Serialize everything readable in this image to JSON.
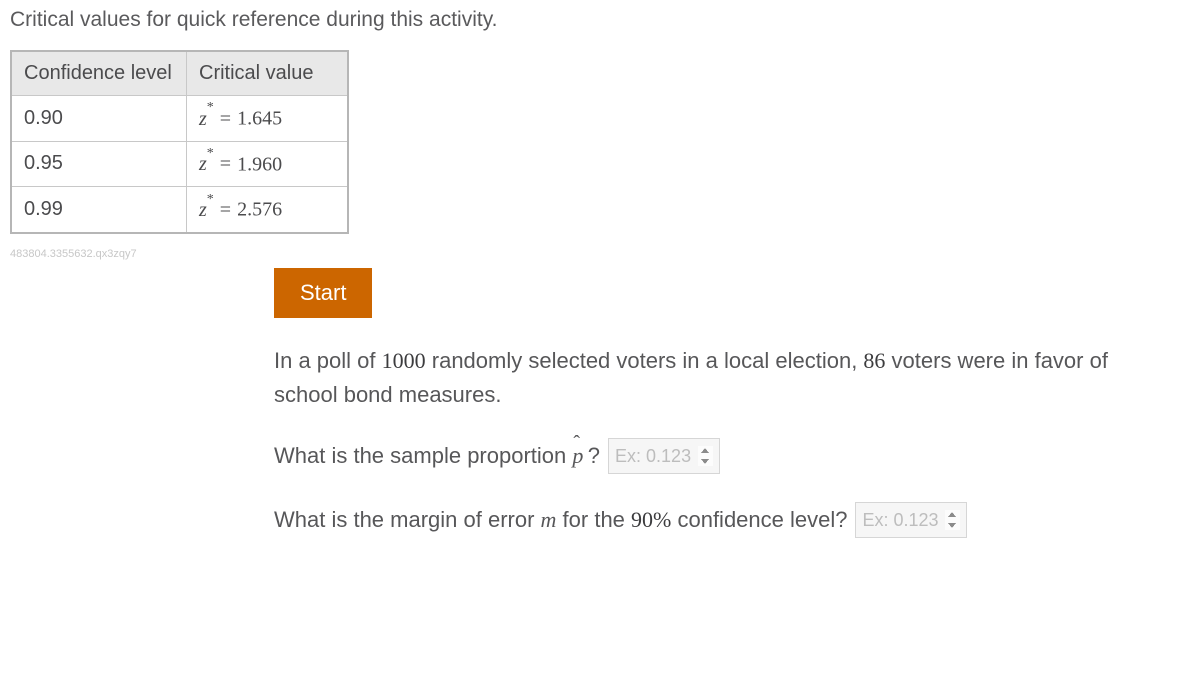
{
  "intro": "Critical values for quick reference during this activity.",
  "table": {
    "headers": {
      "level": "Confidence level",
      "crit": "Critical value"
    },
    "rows": [
      {
        "level": "0.90",
        "z": "1.645"
      },
      {
        "level": "0.95",
        "z": "1.960"
      },
      {
        "level": "0.99",
        "z": "2.576"
      }
    ],
    "z_symbol": "z",
    "eq_symbol": "="
  },
  "watermark": "483804.3355632.qx3zqy7",
  "start_label": "Start",
  "problem": {
    "text_parts": {
      "p1a": "In a poll of ",
      "n": "1000",
      "p1b": " randomly selected voters in a local election, ",
      "k": "86",
      "p1c": " voters were in favor of school bond measures."
    },
    "q1": {
      "before": "What is the sample proportion ",
      "var": "p",
      "after": "?",
      "placeholder": "Ex: 0.123"
    },
    "q2": {
      "before": "What is the margin of error ",
      "var": "m",
      "mid": " for the ",
      "pct": "90%",
      "after": " confidence level?",
      "placeholder": "Ex: 0.123"
    }
  }
}
